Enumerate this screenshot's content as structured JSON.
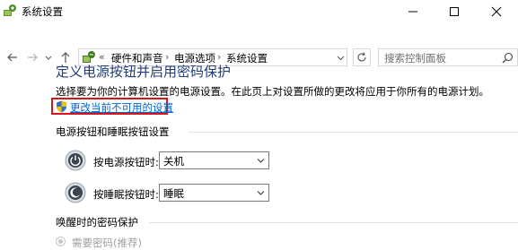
{
  "window": {
    "title": "系统设置",
    "icon": "power-options-icon"
  },
  "nav": {
    "breadcrumb": [
      "硬件和声音",
      "电源选项",
      "系统设置"
    ],
    "overflow": "«",
    "search_placeholder": "搜索控制面板"
  },
  "main": {
    "heading": "定义电源按钮并启用密码保护",
    "description": "选择要为你的计算机设置的电源设置。在此页上对设置所做的更改将应用于你所有的电源计划。",
    "change_link": "更改当前不可用的设置"
  },
  "power_section": {
    "title": "电源按钮和睡眠按钮设置",
    "rows": [
      {
        "label": "按电源按钮时:",
        "value": "关机",
        "icon": "power-button-icon"
      },
      {
        "label": "按睡眠按钮时:",
        "value": "睡眠",
        "icon": "sleep-button-icon"
      }
    ]
  },
  "wake_section": {
    "title": "唤醒时的密码保护",
    "option_label": "需要密码(推荐)"
  },
  "colors": {
    "heading": "#213c7a",
    "link": "#0066cc",
    "highlight_border": "#d9121e"
  }
}
